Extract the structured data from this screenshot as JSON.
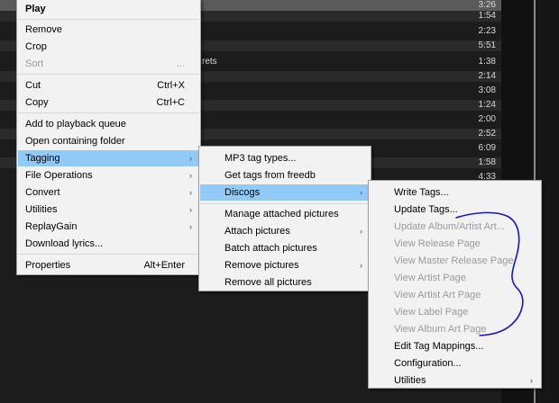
{
  "playlist": {
    "durations": [
      "3:26",
      "1:54",
      "2:23",
      "5:51",
      "1:38",
      "2:14",
      "3:08",
      "1:24",
      "2:00",
      "2:52",
      "6:09",
      "1:58",
      "4:33"
    ],
    "partial_title": "rets"
  },
  "context_menu": {
    "play": "Play",
    "remove": "Remove",
    "crop": "Crop",
    "sort": "Sort",
    "sort_shortcut": "...",
    "cut": "Cut",
    "cut_shortcut": "Ctrl+X",
    "copy": "Copy",
    "copy_shortcut": "Ctrl+C",
    "add_to_queue": "Add to playback queue",
    "open_folder": "Open containing folder",
    "tagging": "Tagging",
    "file_operations": "File Operations",
    "convert": "Convert",
    "utilities": "Utilities",
    "replaygain": "ReplayGain",
    "download_lyrics": "Download lyrics...",
    "properties": "Properties",
    "properties_shortcut": "Alt+Enter",
    "submenu_arrow": "›"
  },
  "tagging_menu": {
    "mp3_tag_types": "MP3 tag types...",
    "get_tags_freedb": "Get tags from freedb",
    "discogs": "Discogs",
    "manage_pictures": "Manage attached pictures",
    "attach_pictures": "Attach pictures",
    "batch_attach": "Batch attach pictures",
    "remove_pictures": "Remove pictures",
    "remove_all_pictures": "Remove all pictures"
  },
  "discogs_menu": {
    "write_tags": "Write Tags...",
    "update_tags": "Update Tags...",
    "update_album_art": "Update Album/Artist Art...",
    "view_release": "View Release Page",
    "view_master_release": "View Master Release Page",
    "view_artist": "View Artist Page",
    "view_artist_art": "View Artist Art Page",
    "view_label": "View Label Page",
    "view_album_art": "View Album Art Page",
    "edit_tag_mappings": "Edit Tag Mappings...",
    "configuration": "Configuration...",
    "utilities": "Utilities"
  },
  "colors": {
    "menu_bg": "#f2f2f2",
    "highlight": "#91c9f7",
    "disabled_text": "#9a9a9a",
    "annotation_ink": "#1414c8"
  }
}
